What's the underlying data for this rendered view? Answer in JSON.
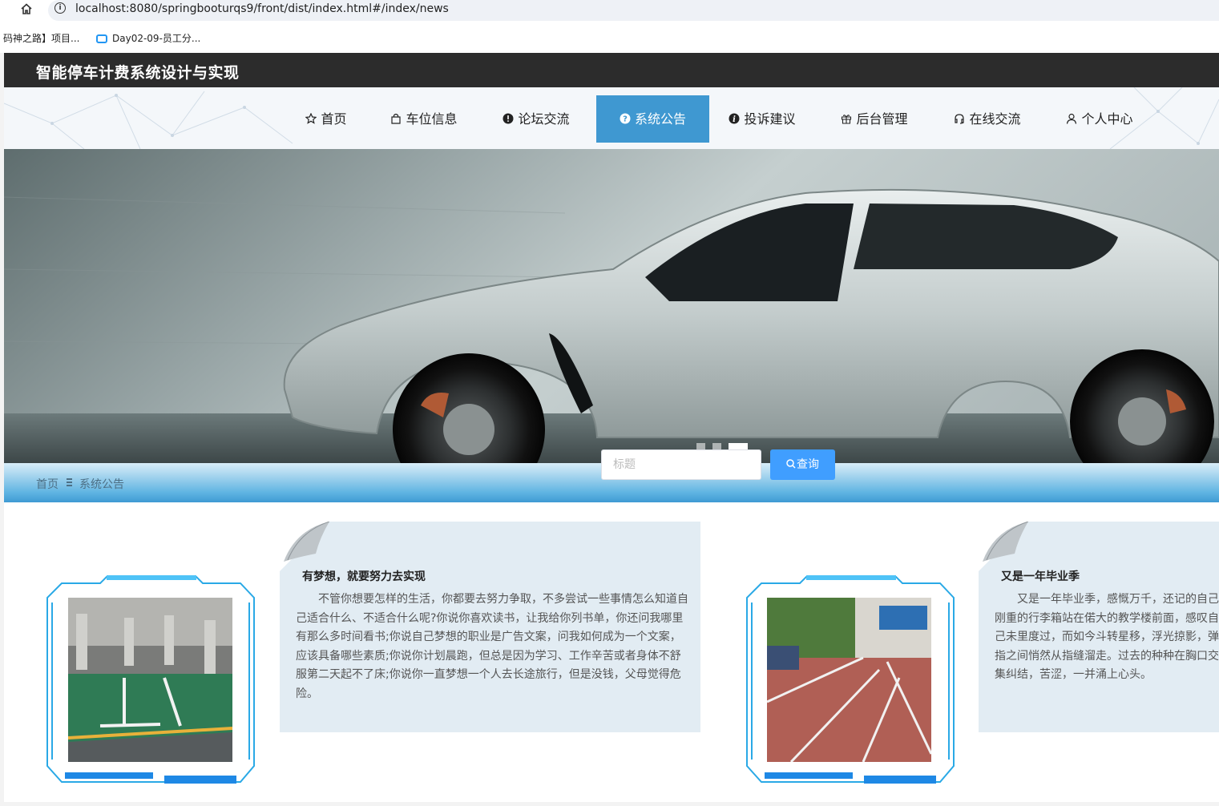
{
  "browser": {
    "url": "localhost:8080/springbooturqs9/front/dist/index.html#/index/news",
    "bookmarks": [
      "码神之路】项目...",
      "Day02-09-员工分..."
    ]
  },
  "app": {
    "title": "智能停车计费系统设计与实现",
    "nav": [
      {
        "label": "首页",
        "icon": "star-icon",
        "active": false
      },
      {
        "label": "车位信息",
        "icon": "bag-icon",
        "active": false
      },
      {
        "label": "论坛交流",
        "icon": "alert-icon",
        "active": false
      },
      {
        "label": "系统公告",
        "icon": "question-icon",
        "active": true
      },
      {
        "label": "投诉建议",
        "icon": "info-icon",
        "active": false
      },
      {
        "label": "后台管理",
        "icon": "gift-icon",
        "active": false
      },
      {
        "label": "在线交流",
        "icon": "headset-icon",
        "active": false
      },
      {
        "label": "个人中心",
        "icon": "user-icon",
        "active": false
      }
    ],
    "carousel": {
      "slides": 3,
      "active_index": 3
    },
    "breadcrumb": {
      "home": "首页",
      "current": "系统公告"
    },
    "search": {
      "placeholder": "标题",
      "button": "查询"
    },
    "news": [
      {
        "title": "有梦想，就要努力去实现",
        "body": "不管你想要怎样的生活，你都要去努力争取，不多尝试一些事情怎么知道自己适合什么、不适合什么呢?你说你喜欢读书，让我给你列书单，你还问我哪里有那么多时间看书;你说自己梦想的职业是广告文案，问我如何成为一个文案，应该具备哪些素质;你说你计划晨跑，但总是因为学习、工作辛苦或者身体不舒服第二天起不了床;你说你一直梦想一个人去长途旅行，但是没钱，父母觉得危险。",
        "image": "underground-parking-photo"
      },
      {
        "title": "又是一年毕业季",
        "body": "又是一年毕业季，感慨万千，还记的自己刚重的行李箱站在偌大的教学楼前面，感叹自己未里度过，而如今斗转星移，浮光掠影，弹指之间悄然从指缝溜走。过去的种种在胸口交集纠结，苦涩，一并涌上心头。",
        "image": "street-parking-photo"
      }
    ],
    "accent_color": "#3f98d1",
    "button_color": "#409eff"
  }
}
